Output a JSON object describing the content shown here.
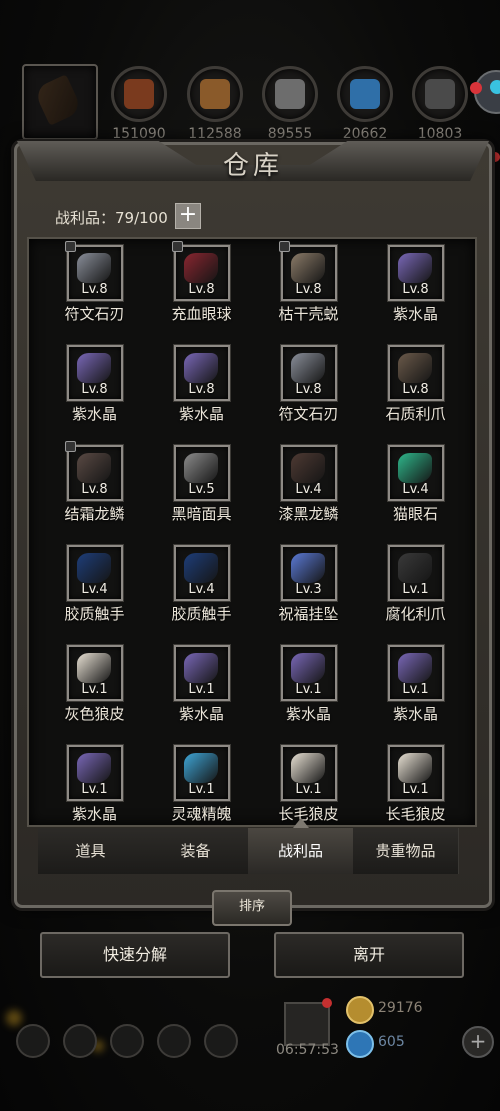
{
  "resources": [
    {
      "icon": "leather-icon",
      "amount": "151090",
      "color": "#7a3a1e"
    },
    {
      "icon": "wood-plank-icon",
      "amount": "112588",
      "color": "#8a5a2a"
    },
    {
      "icon": "iron-ore-icon",
      "amount": "89555",
      "color": "#6d6d6d"
    },
    {
      "icon": "crystal-icon",
      "amount": "20662",
      "color": "#2f6fa8"
    },
    {
      "icon": "anvil-icon",
      "amount": "10803",
      "color": "#4a4a4a"
    }
  ],
  "panel": {
    "title": "仓库"
  },
  "loot": {
    "label": "战利品：79/100",
    "add": "+"
  },
  "items": [
    {
      "name": "符文石刃",
      "level": "Lv.8",
      "locked": true,
      "color": "#8a8f9a"
    },
    {
      "name": "充血眼球",
      "level": "Lv.8",
      "locked": true,
      "color": "#8a2630"
    },
    {
      "name": "枯干壳蜕",
      "level": "Lv.8",
      "locked": true,
      "color": "#8b7b68"
    },
    {
      "name": "紫水晶",
      "level": "Lv.8",
      "locked": false,
      "color": "#7a68b8"
    },
    {
      "name": "紫水晶",
      "level": "Lv.8",
      "locked": false,
      "color": "#7a68b8"
    },
    {
      "name": "紫水晶",
      "level": "Lv.8",
      "locked": false,
      "color": "#7a68b8"
    },
    {
      "name": "符文石刃",
      "level": "Lv.8",
      "locked": false,
      "color": "#8a8f9a"
    },
    {
      "name": "石质利爪",
      "level": "Lv.8",
      "locked": false,
      "color": "#6b5a4a"
    },
    {
      "name": "结霜龙鳞",
      "level": "Lv.8",
      "locked": true,
      "color": "#5a4a44"
    },
    {
      "name": "黑暗面具",
      "level": "Lv.5",
      "locked": false,
      "color": "#8c8c8c"
    },
    {
      "name": "漆黑龙鳞",
      "level": "Lv.4",
      "locked": false,
      "color": "#4e3a33"
    },
    {
      "name": "猫眼石",
      "level": "Lv.4",
      "locked": false,
      "color": "#2fb88c"
    },
    {
      "name": "胶质触手",
      "level": "Lv.4",
      "locked": false,
      "color": "#1e3e7a"
    },
    {
      "name": "胶质触手",
      "level": "Lv.4",
      "locked": false,
      "color": "#1e3e7a"
    },
    {
      "name": "祝福挂坠",
      "level": "Lv.3",
      "locked": false,
      "color": "#5b7ad6"
    },
    {
      "name": "腐化利爪",
      "level": "Lv.1",
      "locked": false,
      "color": "#3a3a3a"
    },
    {
      "name": "灰色狼皮",
      "level": "Lv.1",
      "locked": false,
      "color": "#e8e1d4"
    },
    {
      "name": "紫水晶",
      "level": "Lv.1",
      "locked": false,
      "color": "#7a68b8"
    },
    {
      "name": "紫水晶",
      "level": "Lv.1",
      "locked": false,
      "color": "#7a68b8"
    },
    {
      "name": "紫水晶",
      "level": "Lv.1",
      "locked": false,
      "color": "#7a68b8"
    },
    {
      "name": "紫水晶",
      "level": "Lv.1",
      "locked": false,
      "color": "#7a68b8"
    },
    {
      "name": "灵魂精魄",
      "level": "Lv.1",
      "locked": false,
      "color": "#3fa6d6"
    },
    {
      "name": "长毛狼皮",
      "level": "Lv.1",
      "locked": false,
      "color": "#e8e1d4"
    },
    {
      "name": "长毛狼皮",
      "level": "Lv.1",
      "locked": false,
      "color": "#e8e1d4"
    }
  ],
  "tabs": [
    "道具",
    "装备",
    "战利品",
    "贵重物品"
  ],
  "active_tab": "战利品",
  "sort_label": "排序",
  "actions": {
    "decompose": "快速分解",
    "leave": "离开"
  },
  "bottom": {
    "timer": "06:57:53",
    "gold": "29176",
    "gems": "605"
  }
}
